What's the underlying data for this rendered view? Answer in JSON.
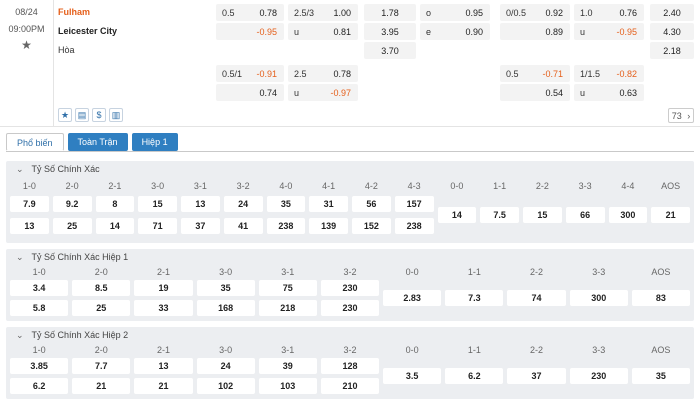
{
  "match": {
    "date": "08/24",
    "time": "09:00PM",
    "home": "Fulham",
    "away": "Leicester City",
    "draw": "Hòa"
  },
  "odds_row1": [
    {
      "lbl": "0.5",
      "val": "0.78",
      "neg": false
    },
    {
      "lbl": "",
      "val": "-0.95",
      "neg": true
    },
    {
      "lbl": "2.5/3",
      "val": "1.00",
      "neg": false
    },
    {
      "lbl": "u",
      "val": "0.81",
      "neg": false
    },
    {
      "lbl": "",
      "val": "1.78",
      "neg": false
    },
    {
      "lbl": "",
      "val": "3.95",
      "neg": false
    },
    {
      "lbl": "",
      "val": "3.70",
      "neg": false
    },
    {
      "lbl": "o",
      "val": "0.95",
      "neg": false
    },
    {
      "lbl": "e",
      "val": "0.90",
      "neg": false
    },
    {
      "lbl": "0/0.5",
      "val": "0.92",
      "neg": false
    },
    {
      "lbl": "",
      "val": "0.89",
      "neg": false
    },
    {
      "lbl": "1.0",
      "val": "0.76",
      "neg": false
    },
    {
      "lbl": "u",
      "val": "-0.95",
      "neg": true
    },
    {
      "lbl": "",
      "val": "2.40",
      "neg": false
    },
    {
      "lbl": "",
      "val": "4.30",
      "neg": false
    },
    {
      "lbl": "",
      "val": "2.18",
      "neg": false
    }
  ],
  "odds_row2": [
    {
      "lbl": "0.5/1",
      "val": "-0.91",
      "neg": true
    },
    {
      "lbl": "",
      "val": "0.74",
      "neg": false
    },
    {
      "lbl": "2.5",
      "val": "0.78",
      "neg": false
    },
    {
      "lbl": "u",
      "val": "-0.97",
      "neg": true
    },
    {
      "lbl": "0.5",
      "val": "-0.71",
      "neg": true
    },
    {
      "lbl": "",
      "val": "0.54",
      "neg": false
    },
    {
      "lbl": "1/1.5",
      "val": "-0.82",
      "neg": true
    },
    {
      "lbl": "u",
      "val": "0.63",
      "neg": false
    }
  ],
  "more_count": "73",
  "tabs": [
    "Phổ biến",
    "Toàn Trận",
    "Hiệp 1"
  ],
  "sections": [
    {
      "title": "Tỷ Số Chính Xác",
      "headers": [
        "1-0",
        "2-0",
        "2-1",
        "3-0",
        "3-1",
        "3-2",
        "4-0",
        "4-1",
        "4-2",
        "4-3",
        "0-0",
        "1-1",
        "2-2",
        "3-3",
        "4-4",
        "AOS"
      ],
      "top": [
        "7.9",
        "9.2",
        "8",
        "15",
        "13",
        "24",
        "35",
        "31",
        "56",
        "157"
      ],
      "bottom": [
        "13",
        "25",
        "14",
        "71",
        "37",
        "41",
        "238",
        "139",
        "152",
        "238"
      ],
      "mid": [
        "14",
        "7.5",
        "15",
        "66",
        "300",
        "21"
      ]
    },
    {
      "title": "Tỷ Số Chính Xác Hiệp 1",
      "headers": [
        "1-0",
        "2-0",
        "2-1",
        "3-0",
        "3-1",
        "3-2",
        "0-0",
        "1-1",
        "2-2",
        "3-3",
        "AOS"
      ],
      "top": [
        "3.4",
        "8.5",
        "19",
        "35",
        "75",
        "230"
      ],
      "bottom": [
        "5.8",
        "25",
        "33",
        "168",
        "218",
        "230"
      ],
      "mid": [
        "2.83",
        "7.3",
        "74",
        "300",
        "83"
      ]
    },
    {
      "title": "Tỷ Số Chính Xác Hiệp 2",
      "headers": [
        "1-0",
        "2-0",
        "2-1",
        "3-0",
        "3-1",
        "3-2",
        "0-0",
        "1-1",
        "2-2",
        "3-3",
        "AOS"
      ],
      "top": [
        "3.85",
        "7.7",
        "13",
        "24",
        "39",
        "128"
      ],
      "bottom": [
        "6.2",
        "21",
        "21",
        "102",
        "103",
        "210"
      ],
      "mid": [
        "3.5",
        "6.2",
        "37",
        "230",
        "35"
      ]
    }
  ]
}
